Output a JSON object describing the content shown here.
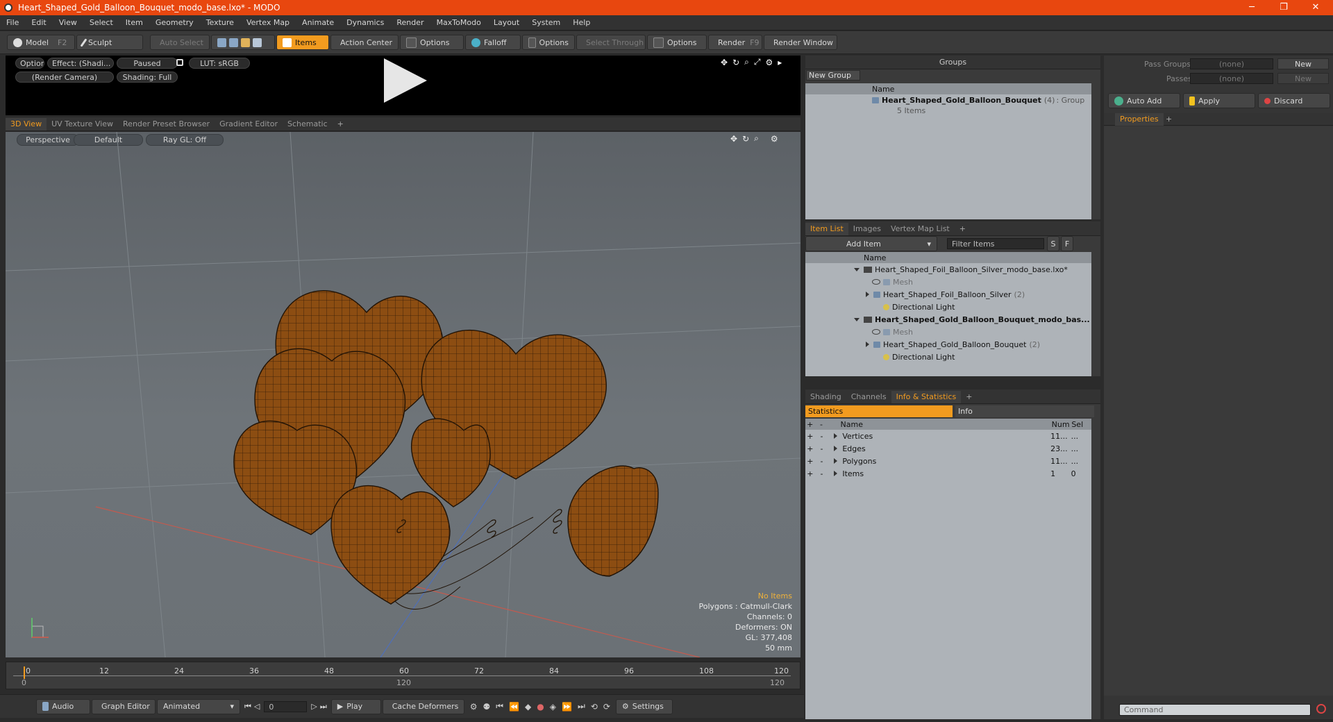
{
  "window": {
    "title": "Heart_Shaped_Gold_Balloon_Bouquet_modo_base.lxo* - MODO",
    "minimize": "─",
    "maximize": "❐",
    "close": "✕"
  },
  "menu": [
    "File",
    "Edit",
    "View",
    "Select",
    "Item",
    "Geometry",
    "Texture",
    "Vertex Map",
    "Animate",
    "Dynamics",
    "Render",
    "MaxToModo",
    "Layout",
    "System",
    "Help"
  ],
  "toolbar": {
    "model": "Model",
    "model_key": "F2",
    "sculpt": "Sculpt",
    "auto_select": "Auto Select",
    "items": "Items",
    "action_center": "Action Center",
    "options1": "Options",
    "falloff": "Falloff",
    "options2": "Options",
    "select_through": "Select Through",
    "options3": "Options",
    "render": "Render",
    "render_key": "F9",
    "render_window": "Render Window"
  },
  "preview": {
    "options": "Options",
    "effect": "Effect: (Shadi...",
    "paused": "Paused",
    "lut": "LUT: sRGB",
    "camera": "(Render Camera)",
    "shading": "Shading: Full"
  },
  "viewport_tabs": [
    "3D View",
    "UV Texture View",
    "Render Preset Browser",
    "Gradient Editor",
    "Schematic",
    "+"
  ],
  "viewport": {
    "perspective": "Perspective",
    "default": "Default",
    "raygl": "Ray GL: Off",
    "info": {
      "no_items": "No Items",
      "polygons": "Polygons : Catmull-Clark",
      "channels": "Channels: 0",
      "deformers": "Deformers: ON",
      "gl": "GL: 377,408",
      "lens": "50 mm"
    }
  },
  "timeline": {
    "ticks": [
      "0",
      "12",
      "24",
      "36",
      "48",
      "60",
      "72",
      "84",
      "96",
      "108",
      "120"
    ],
    "range_start": "0",
    "range_mid": "120",
    "range_end": "120"
  },
  "transport": {
    "audio": "Audio",
    "graph_editor": "Graph Editor",
    "animated": "Animated",
    "frame": "0",
    "play": "Play",
    "cache_deformers": "Cache Deformers",
    "settings": "Settings"
  },
  "groups": {
    "title": "Groups",
    "new_group": "New Group",
    "col_name": "Name",
    "item_name": "Heart_Shaped_Gold_Balloon_Bouquet",
    "item_count": "(4)",
    "item_type": ": Group",
    "item_sub": "5 Items"
  },
  "item_list": {
    "tabs": [
      "Item List",
      "Images",
      "Vertex Map List",
      "+"
    ],
    "add_item": "Add Item",
    "filter": "Filter Items",
    "btn_s": "S",
    "btn_f": "F",
    "col_name": "Name",
    "rows": [
      {
        "label": "Heart_Shaped_Foil_Balloon_Silver_modo_base.lxo*",
        "count": "",
        "bold": false,
        "dim": false
      },
      {
        "label": "Mesh",
        "count": "",
        "bold": false,
        "dim": true
      },
      {
        "label": "Heart_Shaped_Foil_Balloon_Silver",
        "count": "(2)",
        "bold": false,
        "dim": false
      },
      {
        "label": "Directional Light",
        "count": "",
        "bold": false,
        "dim": false
      },
      {
        "label": "Heart_Shaped_Gold_Balloon_Bouquet_modo_bas...",
        "count": "",
        "bold": true,
        "dim": false
      },
      {
        "label": "Mesh",
        "count": "",
        "bold": false,
        "dim": true
      },
      {
        "label": "Heart_Shaped_Gold_Balloon_Bouquet",
        "count": "(2)",
        "bold": false,
        "dim": false
      },
      {
        "label": "Directional Light",
        "count": "",
        "bold": false,
        "dim": false
      }
    ]
  },
  "stats": {
    "tabs": [
      "Shading",
      "Channels",
      "Info & Statistics",
      "+"
    ],
    "subtab_stats": "Statistics",
    "subtab_info": "Info",
    "col_name": "Name",
    "col_num": "Num",
    "col_sel": "Sel",
    "rows": [
      {
        "name": "Vertices",
        "num": "11...",
        "sel": "..."
      },
      {
        "name": "Edges",
        "num": "23...",
        "sel": "..."
      },
      {
        "name": "Polygons",
        "num": "11...",
        "sel": "..."
      },
      {
        "name": "Items",
        "num": "1",
        "sel": "0"
      }
    ]
  },
  "right_panel": {
    "pass_groups": "Pass Groups",
    "passes": "Passes",
    "none1": "(none)",
    "none2": "(none)",
    "new1": "New",
    "new2": "New",
    "auto_add": "Auto Add",
    "apply": "Apply",
    "discard": "Discard",
    "properties_tab": "Properties",
    "plus": "+",
    "command_placeholder": "Command"
  }
}
